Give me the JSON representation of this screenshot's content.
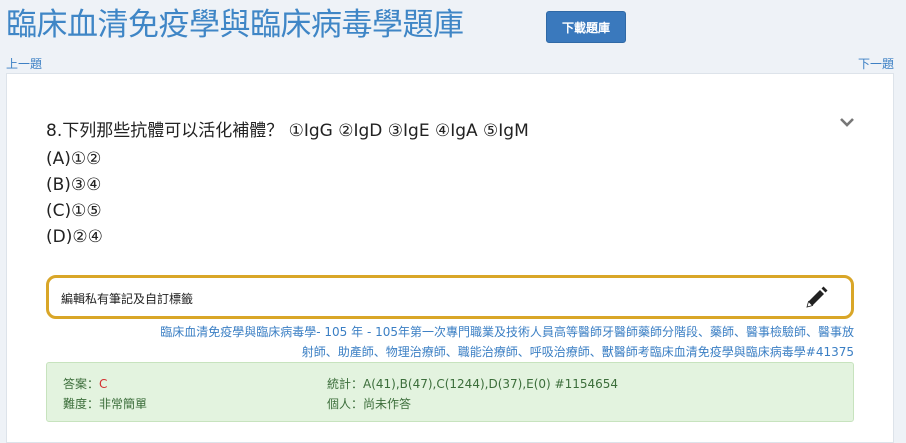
{
  "header": {
    "title": "臨床血清免疫學與臨床病毒學題庫",
    "download_label": "下載題庫"
  },
  "nav": {
    "prev_label": "上一題",
    "next_label": "下一題"
  },
  "question": {
    "text": "8.下列那些抗體可以活化補體？ ①IgG ②IgD ③IgE ④IgA ⑤IgM",
    "options": [
      "(A)①②",
      "(B)③④",
      "(C)①⑤",
      "(D)②④"
    ]
  },
  "note": {
    "label": "編輯私有筆記及自訂標籤"
  },
  "source": {
    "line1": "臨床血清免疫學與臨床病毒學- 105 年 - 105年第一次專門職業及技術人員高等醫師牙醫師藥師分階段、藥師、醫事檢驗師、醫事放",
    "line2": "射師、助產師、物理治療師、職能治療師、呼吸治療師、獸醫師考臨床血清免疫學與臨床病毒學#41375"
  },
  "answer": {
    "answer_label": "答案：",
    "answer_value": "C",
    "difficulty_label": "難度：",
    "difficulty_value": "非常簡單",
    "stats_label": "統計：",
    "stats_value": "A(41),B(47),C(1244),D(37),E(0) #1154654",
    "personal_label": "個人：",
    "personal_value": "尚未作答"
  },
  "colors": {
    "accent": "#3a79bd",
    "title": "#3f86c6",
    "note_border": "#d9a628",
    "answer_bg": "#e3f3df",
    "answer_red": "#d32f2f"
  },
  "icons": {
    "collapse": "chevron-down-icon",
    "edit": "pencil-icon"
  }
}
